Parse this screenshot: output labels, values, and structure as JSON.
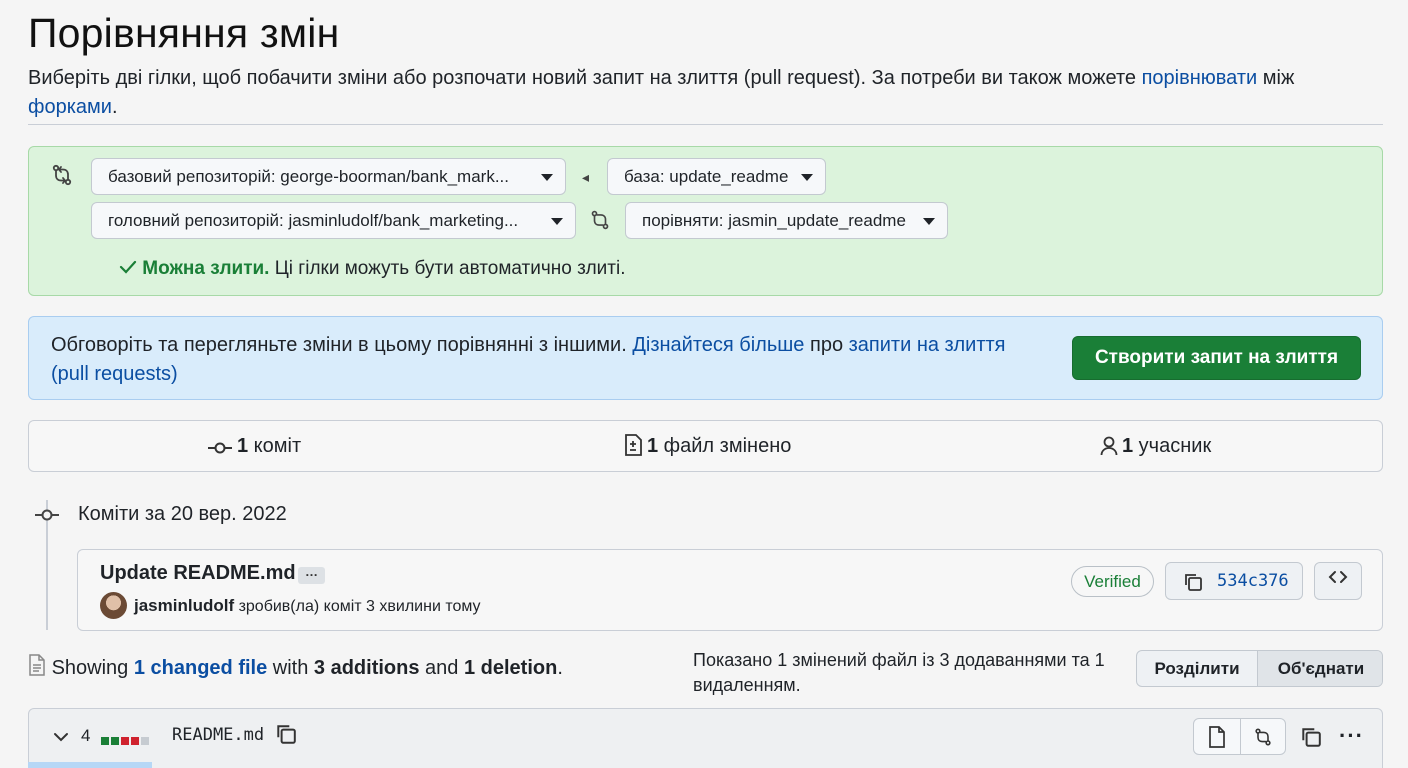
{
  "header": {
    "title": "Порівняння змін",
    "desc_before": "Виберіть дві гілки, щоб побачити зміни або розпочати новий запит на злиття (pull request). За потреби ви також можете ",
    "desc_link1": "порівнювати",
    "desc_middle": " між ",
    "desc_link2": "форками",
    "desc_after": "."
  },
  "range": {
    "base_repo": "базовий репозиторій: george-boorman/bank_mark...",
    "base_branch": "база: update_readme",
    "head_repo": "головний репозиторій: jasminludolf/bank_marketing...",
    "compare_branch": "порівняти: jasmin_update_readme",
    "merge_ok": "Можна злити.",
    "merge_text": " Ці гілки можуть бути автоматично злиті."
  },
  "notice": {
    "text_before": "Обговоріть та перегляньте зміни в цьому порівнянні з іншими. ",
    "link1": "Дізнайтеся більше",
    "text_middle": " про ",
    "link2": "запити на злиття (pull requests)",
    "create_button": "Створити запит на злиття"
  },
  "stats": {
    "commits_count": "1",
    "commits_label": " коміт",
    "files_count": "1",
    "files_label": " файл змінено",
    "contributors_count": "1",
    "contributors_label": " учасник"
  },
  "timeline": {
    "date_heading": "Коміти за 20 вер. 2022",
    "commit": {
      "title": "Update README.md",
      "ellipsis": "…",
      "author": "jasminludolf",
      "meta": " зробив(ла) коміт 3 хвилини тому",
      "verified": "Verified",
      "sha": "534c376"
    }
  },
  "summary": {
    "showing": "Showing ",
    "changed_link": "1 changed file",
    "with": " with ",
    "additions": "3 additions",
    "and": " and ",
    "deletions": "1 deletion",
    "period": ".",
    "uk_text": "Показано 1 змінений файл із 3 додаваннями та 1 видаленням.",
    "split_label": "Розділити",
    "unified_label": "Об'єднати"
  },
  "file": {
    "count": "4",
    "name": "README.md",
    "diffstat": {
      "added": 2,
      "deleted": 2,
      "neutral": 1
    }
  },
  "colors": {
    "green": "#1a7f37",
    "red": "#cf222e",
    "link": "#0b4ea2"
  }
}
